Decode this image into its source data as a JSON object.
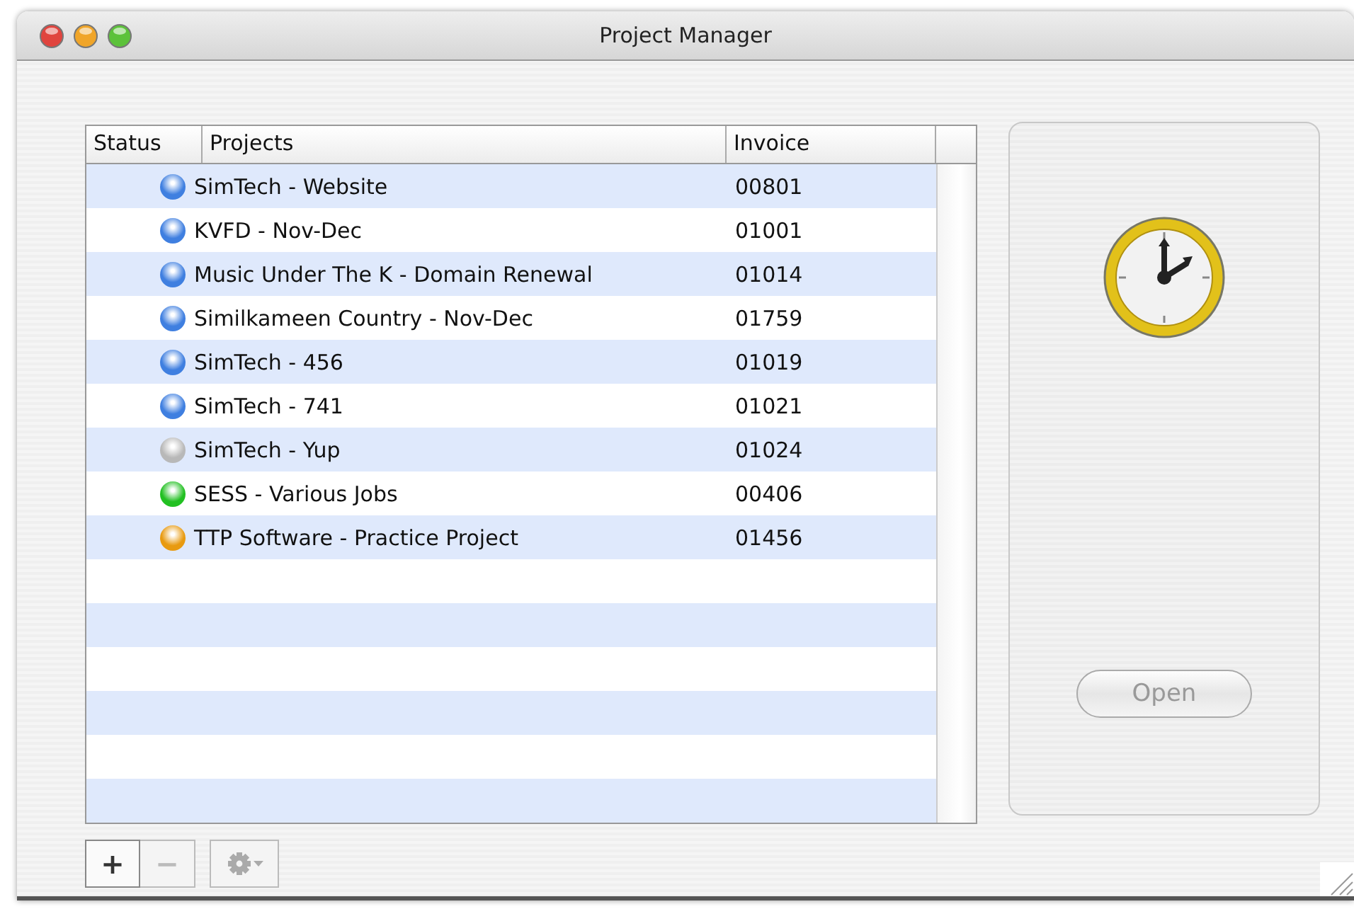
{
  "window": {
    "title": "Project Manager"
  },
  "table": {
    "columns": [
      "Status",
      "Projects",
      "Invoice"
    ],
    "rows": [
      {
        "color": "#3f7fe0",
        "project": "SimTech - Website",
        "invoice": "00801"
      },
      {
        "color": "#3f7fe0",
        "project": "KVFD - Nov-Dec",
        "invoice": "01001"
      },
      {
        "color": "#3f7fe0",
        "project": "Music Under The K - Domain Renewal",
        "invoice": "01014"
      },
      {
        "color": "#3f7fe0",
        "project": "Similkameen Country - Nov-Dec",
        "invoice": "01759"
      },
      {
        "color": "#3f7fe0",
        "project": "SimTech - 456",
        "invoice": "01019"
      },
      {
        "color": "#3f7fe0",
        "project": "SimTech - 741",
        "invoice": "01021"
      },
      {
        "color": "#b8b8b8",
        "project": "SimTech - Yup",
        "invoice": "01024"
      },
      {
        "color": "#22c022",
        "project": "SESS - Various Jobs",
        "invoice": "00406"
      },
      {
        "color": "#e89a10",
        "project": "TTP Software - Practice Project",
        "invoice": "01456"
      }
    ]
  },
  "toolbar": {
    "add": {
      "label": "+",
      "disabled": false
    },
    "remove": {
      "label": "−",
      "disabled": true
    },
    "actions_disabled": true
  },
  "open_button": {
    "label": "Open",
    "disabled": true
  }
}
